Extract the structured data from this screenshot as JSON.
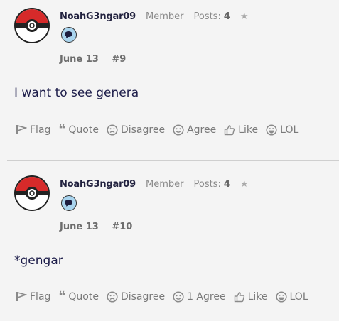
{
  "posts": [
    {
      "username": "NoahG3ngar09",
      "role": "Member",
      "posts_label": "Posts:",
      "posts_count": "4",
      "date": "June 13",
      "permalink": "#9",
      "content": "I want to see genera",
      "actions": {
        "flag": "Flag",
        "quote": "Quote",
        "disagree": "Disagree",
        "agree": "Agree",
        "like": "Like",
        "lol": "LOL"
      }
    },
    {
      "username": "NoahG3ngar09",
      "role": "Member",
      "posts_label": "Posts:",
      "posts_count": "4",
      "date": "June 13",
      "permalink": "#10",
      "content": "*gengar",
      "actions": {
        "flag": "Flag",
        "quote": "Quote",
        "disagree": "Disagree",
        "agree": "1 Agree",
        "like": "Like",
        "lol": "LOL"
      }
    }
  ],
  "icons": {
    "avatar": "pokeball-icon",
    "badge": "speech-bubble-icon",
    "star": "star-icon",
    "flag": "flag-icon",
    "quote": "quote-icon",
    "disagree": "frown-icon",
    "agree": "smile-icon",
    "like": "thumbs-up-icon",
    "lol": "laugh-icon"
  },
  "colors": {
    "background": "#f4f4f4",
    "username": "#22223f",
    "muted": "#8a8a8a",
    "avatar_red": "#d62a2a",
    "badge_blue": "#a9d4ee"
  }
}
